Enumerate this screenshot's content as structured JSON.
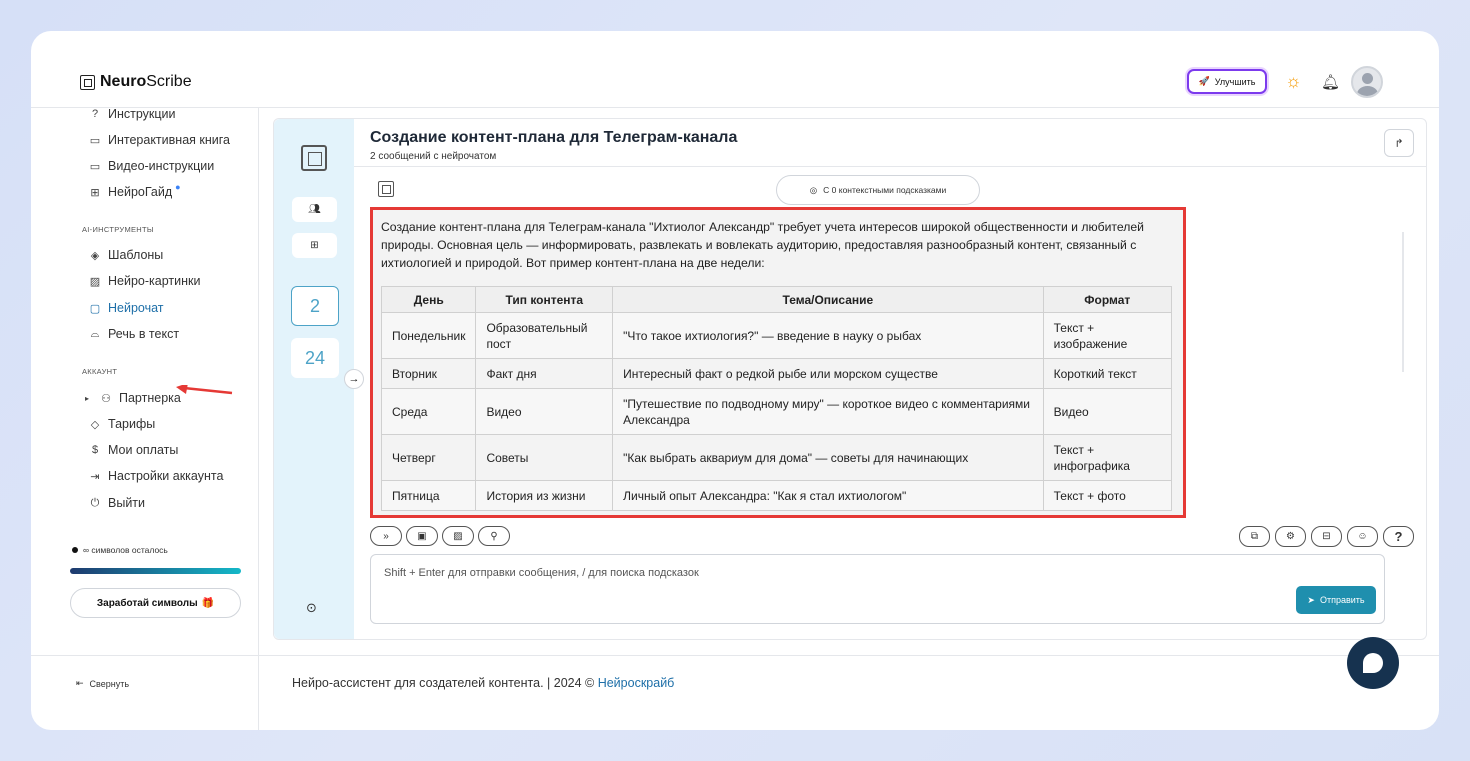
{
  "header": {
    "logo_bold": "Neuro",
    "logo_rest": "Scribe",
    "upgrade_label": "Улучшить"
  },
  "sidebar": {
    "top_items": [
      {
        "label": "Инструкции",
        "icon": "question-icon"
      },
      {
        "label": "Интерактивная книга",
        "icon": "book-icon"
      },
      {
        "label": "Видео-инструкции",
        "icon": "video-icon"
      },
      {
        "label": "НейроГайд",
        "icon": "guide-icon"
      }
    ],
    "ai_section": "AI-ИНСТРУМЕНТЫ",
    "ai_items": [
      {
        "label": "Шаблоны",
        "icon": "layers-icon"
      },
      {
        "label": "Нейро-картинки",
        "icon": "image-icon"
      },
      {
        "label": "Нейрочат",
        "icon": "chat-icon",
        "active": true
      },
      {
        "label": "Речь в текст",
        "icon": "headphones-icon"
      }
    ],
    "account_section": "АККАУНТ",
    "account_items": [
      {
        "label": "Партнерка",
        "icon": "users-icon"
      },
      {
        "label": "Тарифы",
        "icon": "tag-icon"
      },
      {
        "label": "Мои оплаты",
        "icon": "dollar-icon"
      },
      {
        "label": "Настройки аккаунта",
        "icon": "settings-icon"
      },
      {
        "label": "Выйти",
        "icon": "power-icon"
      }
    ],
    "symbols_left": "∞ символов осталось",
    "earn_label": "Заработай символы",
    "collapse_label": "Свернуть"
  },
  "rail": {
    "numbers": [
      "2",
      "24"
    ]
  },
  "chat": {
    "title": "Создание контент-плана для Телеграм-канала",
    "subtitle": "2 сообщений с нейрочатом",
    "context_pill": "С 0 контекстными подсказками",
    "answer_intro": "Создание контент-плана для Телеграм-канала \"Ихтиолог Александр\" требует учета интересов широкой общественности и любителей природы. Основная цель — информировать, развлекать и вовлекать аудиторию, предоставляя разнообразный контент, связанный с ихтиологией и природой. Вот пример контент-плана на две недели:",
    "table": {
      "headers": [
        "День",
        "Тип контента",
        "Тема/Описание",
        "Формат"
      ],
      "rows": [
        [
          "Понедельник",
          "Образовательный пост",
          "\"Что такое ихтиология?\" — введение в науку о рыбах",
          "Текст + изображение"
        ],
        [
          "Вторник",
          "Факт дня",
          "Интересный факт о редкой рыбе или морском существе",
          "Короткий текст"
        ],
        [
          "Среда",
          "Видео",
          "\"Путешествие по подводному миру\" — короткое видео с комментариями Александра",
          "Видео"
        ],
        [
          "Четверг",
          "Советы",
          "\"Как выбрать аквариум для дома\" — советы для начинающих",
          "Текст + инфографика"
        ],
        [
          "Пятница",
          "История из жизни",
          "Личный опыт Александра: \"Как я стал ихтиологом\"",
          "Текст + фото"
        ]
      ]
    },
    "input_placeholder": "Shift + Enter для отправки сообщения, / для поиска подсказок",
    "send_label": "Отправить"
  },
  "footer": {
    "text": "Нейро-ассистент для создателей контента.  | 2024 © ",
    "brand": "Нейроскрайб"
  }
}
